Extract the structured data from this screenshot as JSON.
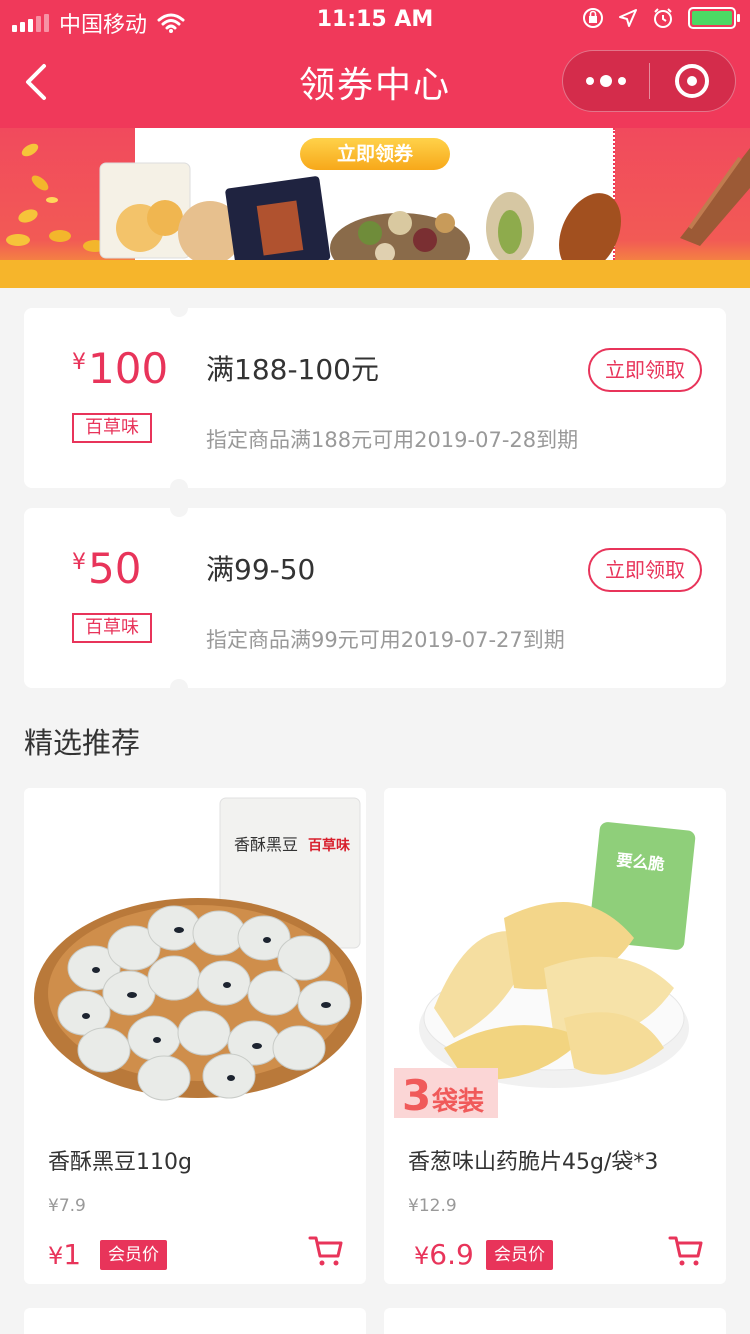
{
  "status_bar": {
    "carrier": "中国移动",
    "time": "11:15 AM"
  },
  "nav": {
    "title": "领券中心"
  },
  "banner": {
    "button_label": "立即领券"
  },
  "coupons": [
    {
      "currency": "¥",
      "amount": "100",
      "brand": "百草味",
      "title": "满188-100元",
      "desc": "指定商品满188元可用2019-07-28到期",
      "button": "立即领取"
    },
    {
      "currency": "¥",
      "amount": "50",
      "brand": "百草味",
      "title": "满99-50",
      "desc": "指定商品满99元可用2019-07-27到期",
      "button": "立即领取"
    }
  ],
  "section": {
    "title": "精选推荐"
  },
  "products": [
    {
      "name": "香酥黑豆110g",
      "orig_price": "¥7.9",
      "currency": "¥",
      "price": "1",
      "vip_label": "会员价",
      "package_text": "香酥黑豆",
      "brand_text": "百草味"
    },
    {
      "name": "香葱味山药脆片45g/袋*3",
      "orig_price": "¥12.9",
      "currency": "¥",
      "price": "6.9",
      "vip_label": "会员价",
      "package_text": "要么脆",
      "pack_badge_num": "3",
      "pack_badge_text": "袋装"
    }
  ],
  "colors": {
    "brand": "#f0395a",
    "accent": "#e8345a",
    "banner_yellow": "#f6b52b"
  },
  "icons": [
    "signal-icon",
    "wifi-icon",
    "lock-rotation-icon",
    "location-icon",
    "alarm-icon",
    "battery-icon",
    "back-icon",
    "more-icon",
    "close-mini-program-icon",
    "cart-icon"
  ]
}
